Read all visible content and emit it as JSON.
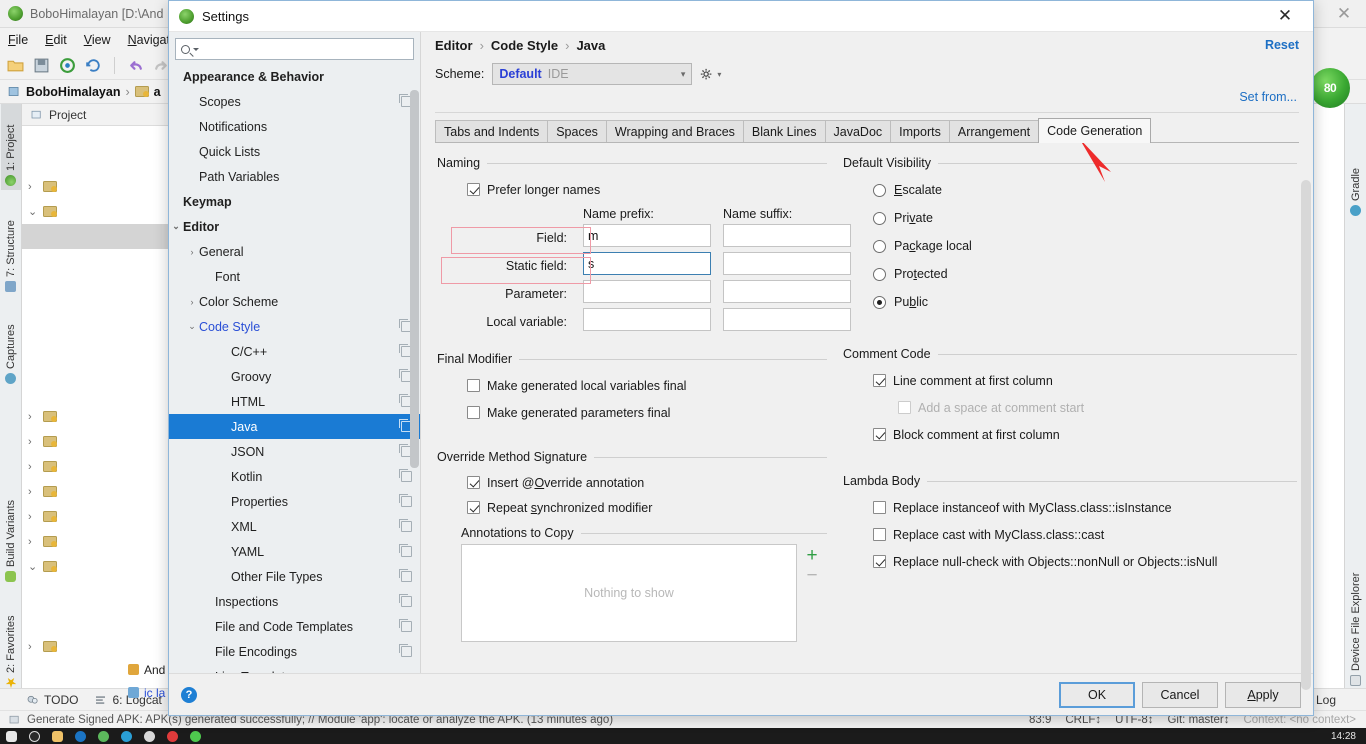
{
  "ide": {
    "window_title": "BoboHimalayan [D:\\And",
    "menu": [
      "File",
      "Edit",
      "View",
      "Navigate"
    ],
    "breadcrumb": [
      "BoboHimalayan",
      "a"
    ],
    "project_panel_title": "Project",
    "left_tool_tabs": [
      "1: Project",
      "7: Structure",
      "Captures",
      "Build Variants",
      "2: Favorites"
    ],
    "right_tool_tabs": [
      "Gradle",
      "Device File Explorer"
    ],
    "gradle_badge": "80",
    "tree_leaf_labels": [
      "And",
      "ic la"
    ],
    "status_tabs": [
      "TODO",
      "6: Logcat"
    ],
    "status_message": "Generate Signed APK: APK(s) generated successfully; // Module 'app': locate or analyze the APK. (13 minutes ago)",
    "status_right": [
      "83:9",
      "CRLF↕",
      "UTF-8↕",
      "Git: master↕",
      "Context: <no context>"
    ],
    "clock": "14:28",
    "log_tab": "Log"
  },
  "dialog": {
    "title": "Settings",
    "close_icon": "close-icon",
    "search": {
      "value": "",
      "placeholder": ""
    },
    "nav_items": [
      {
        "label": "Appearance & Behavior",
        "bold": true,
        "indent": 0,
        "arrow": "",
        "copy": false,
        "selected": false
      },
      {
        "label": "Scopes",
        "bold": false,
        "indent": 1,
        "arrow": "",
        "copy": true,
        "selected": false
      },
      {
        "label": "Notifications",
        "bold": false,
        "indent": 1,
        "arrow": "",
        "copy": false,
        "selected": false
      },
      {
        "label": "Quick Lists",
        "bold": false,
        "indent": 1,
        "arrow": "",
        "copy": false,
        "selected": false
      },
      {
        "label": "Path Variables",
        "bold": false,
        "indent": 1,
        "arrow": "",
        "copy": false,
        "selected": false
      },
      {
        "label": "Keymap",
        "bold": true,
        "indent": 0,
        "arrow": "",
        "copy": false,
        "selected": false
      },
      {
        "label": "Editor",
        "bold": true,
        "indent": 0,
        "arrow": "⌄",
        "copy": false,
        "selected": false
      },
      {
        "label": "General",
        "bold": false,
        "indent": 1,
        "arrow": "›",
        "copy": false,
        "selected": false
      },
      {
        "label": "Font",
        "bold": false,
        "indent": 2,
        "arrow": "",
        "copy": false,
        "selected": false
      },
      {
        "label": "Color Scheme",
        "bold": false,
        "indent": 1,
        "arrow": "›",
        "copy": false,
        "selected": false
      },
      {
        "label": "Code Style",
        "bold": false,
        "indent": 1,
        "arrow": "⌄",
        "copy": true,
        "selected": false,
        "link": true
      },
      {
        "label": "C/C++",
        "bold": false,
        "indent": 3,
        "arrow": "",
        "copy": true,
        "selected": false
      },
      {
        "label": "Groovy",
        "bold": false,
        "indent": 3,
        "arrow": "",
        "copy": true,
        "selected": false
      },
      {
        "label": "HTML",
        "bold": false,
        "indent": 3,
        "arrow": "",
        "copy": true,
        "selected": false
      },
      {
        "label": "Java",
        "bold": false,
        "indent": 3,
        "arrow": "",
        "copy": true,
        "selected": true
      },
      {
        "label": "JSON",
        "bold": false,
        "indent": 3,
        "arrow": "",
        "copy": true,
        "selected": false
      },
      {
        "label": "Kotlin",
        "bold": false,
        "indent": 3,
        "arrow": "",
        "copy": true,
        "selected": false
      },
      {
        "label": "Properties",
        "bold": false,
        "indent": 3,
        "arrow": "",
        "copy": true,
        "selected": false
      },
      {
        "label": "XML",
        "bold": false,
        "indent": 3,
        "arrow": "",
        "copy": true,
        "selected": false
      },
      {
        "label": "YAML",
        "bold": false,
        "indent": 3,
        "arrow": "",
        "copy": true,
        "selected": false
      },
      {
        "label": "Other File Types",
        "bold": false,
        "indent": 3,
        "arrow": "",
        "copy": true,
        "selected": false
      },
      {
        "label": "Inspections",
        "bold": false,
        "indent": 2,
        "arrow": "",
        "copy": true,
        "selected": false
      },
      {
        "label": "File and Code Templates",
        "bold": false,
        "indent": 2,
        "arrow": "",
        "copy": true,
        "selected": false
      },
      {
        "label": "File Encodings",
        "bold": false,
        "indent": 2,
        "arrow": "",
        "copy": true,
        "selected": false
      },
      {
        "label": "Live Templates",
        "bold": false,
        "indent": 2,
        "arrow": "",
        "copy": false,
        "selected": false
      }
    ],
    "breadcrumbs": [
      "Editor",
      "Code Style",
      "Java"
    ],
    "reset_label": "Reset",
    "scheme_label": "Scheme:",
    "scheme_value": "Default",
    "scheme_value_dim": "IDE",
    "set_from_label": "Set from...",
    "tabs": [
      {
        "label": "Tabs and Indents",
        "active": false
      },
      {
        "label": "Spaces",
        "active": false
      },
      {
        "label": "Wrapping and Braces",
        "active": false
      },
      {
        "label": "Blank Lines",
        "active": false
      },
      {
        "label": "JavaDoc",
        "active": false
      },
      {
        "label": "Imports",
        "active": false
      },
      {
        "label": "Arrangement",
        "active": false
      },
      {
        "label": "Code Generation",
        "active": true
      }
    ],
    "naming": {
      "title": "Naming",
      "prefer_longer_names": {
        "label": "Prefer longer names",
        "checked": true
      },
      "col_prefix": "Name prefix:",
      "col_suffix": "Name suffix:",
      "rows": [
        {
          "label": "Field:",
          "prefix": "m",
          "suffix": "",
          "highlighted": true,
          "focused": false
        },
        {
          "label": "Static field:",
          "prefix": "s",
          "suffix": "",
          "highlighted": true,
          "focused": true
        },
        {
          "label": "Parameter:",
          "prefix": "",
          "suffix": "",
          "highlighted": false,
          "focused": false
        },
        {
          "label": "Local variable:",
          "prefix": "",
          "suffix": "",
          "highlighted": false,
          "focused": false
        }
      ]
    },
    "final_modifier": {
      "title": "Final Modifier",
      "items": [
        {
          "label": "Make generated local variables final",
          "checked": false
        },
        {
          "label": "Make generated parameters final",
          "checked": false
        }
      ]
    },
    "override_method_signature": {
      "title": "Override Method Signature",
      "items": [
        {
          "label": "Insert @Override annotation",
          "checked": true,
          "mnemonic": "O"
        },
        {
          "label": "Repeat synchronized modifier",
          "checked": true,
          "mnemonic": "s"
        }
      ],
      "annotations_title": "Annotations to Copy",
      "annotations_empty": "Nothing to show",
      "add_label": "+",
      "remove_label": "−"
    },
    "default_visibility": {
      "title": "Default Visibility",
      "options": [
        {
          "label": "Escalate",
          "selected": false,
          "mnemonic": "E"
        },
        {
          "label": "Private",
          "selected": false,
          "mnemonic": "v"
        },
        {
          "label": "Package local",
          "selected": false,
          "mnemonic": "c"
        },
        {
          "label": "Protected",
          "selected": false,
          "mnemonic": "t"
        },
        {
          "label": "Public",
          "selected": true,
          "mnemonic": "b"
        }
      ]
    },
    "comment_code": {
      "title": "Comment Code",
      "items": [
        {
          "label": "Line comment at first column",
          "checked": true,
          "disabled": false,
          "indent": 1
        },
        {
          "label": "Add a space at comment start",
          "checked": false,
          "disabled": true,
          "indent": 2
        },
        {
          "label": "Block comment at first column",
          "checked": true,
          "disabled": false,
          "indent": 1
        }
      ]
    },
    "lambda_body": {
      "title": "Lambda Body",
      "items": [
        {
          "label": "Replace instanceof with MyClass.class::isInstance",
          "checked": false
        },
        {
          "label": "Replace cast with MyClass.class::cast",
          "checked": false
        },
        {
          "label": "Replace null-check with Objects::nonNull or Objects::isNull",
          "checked": true
        }
      ]
    },
    "footer": {
      "help_label": "?",
      "ok_label": "OK",
      "cancel_label": "Cancel",
      "apply_label": "Apply"
    }
  },
  "colors": {
    "accent": "#1a7bd4",
    "link": "#1d6fc4",
    "highlight_box": "#ef9aa6",
    "arrow": "#ee2b2b",
    "selection": "#1a7bd4"
  }
}
